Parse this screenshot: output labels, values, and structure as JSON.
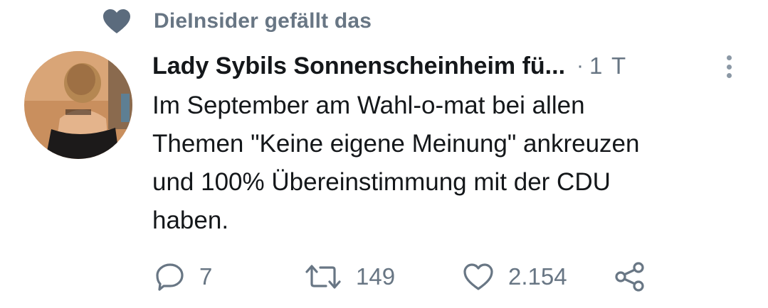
{
  "social_context": {
    "icon": "heart-icon",
    "text": "DieInsider gefällt das",
    "color": "#687684"
  },
  "tweet": {
    "display_name": "Lady Sybils Sonnenscheinheim fü...",
    "separator": "·",
    "time": "1 T",
    "text": "Im September am Wahl-o-mat bei allen\nThemen \"Keine eigene Meinung\" ankreuzen\nund 100% Übereinstimmung mit der CDU\nhaben."
  },
  "actions": {
    "reply": {
      "icon": "reply-icon",
      "count": "7"
    },
    "retweet": {
      "icon": "retweet-icon",
      "count": "149"
    },
    "like": {
      "icon": "like-icon",
      "count": "2.154"
    },
    "share": {
      "icon": "share-icon"
    }
  },
  "colors": {
    "secondary_text": "#687684",
    "primary_text": "#14171a"
  }
}
